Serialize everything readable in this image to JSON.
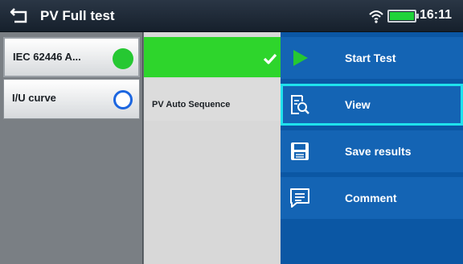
{
  "header": {
    "title": "PV Full test",
    "time": "16:11",
    "battery_level": 1.0,
    "icons": [
      "back-icon",
      "wifi-icon",
      "battery-icon"
    ]
  },
  "left_list": {
    "items": [
      {
        "label": "IEC 62446 A...",
        "status": "passed",
        "status_color": "#26c832"
      },
      {
        "label": "I/U curve",
        "status": "pending",
        "status_color": "#1c66e0"
      }
    ]
  },
  "middle": {
    "header_color": "#2ed52c",
    "header_icon": "check-icon",
    "item_label": "PV Auto Sequence"
  },
  "menu": {
    "accent_color": "#1fe1ec",
    "items": [
      {
        "label": "Start Test",
        "icon": "play-icon"
      },
      {
        "label": "View",
        "icon": "view-icon"
      },
      {
        "label": "Save results",
        "icon": "save-icon"
      },
      {
        "label": "Comment",
        "icon": "comment-icon"
      }
    ]
  }
}
